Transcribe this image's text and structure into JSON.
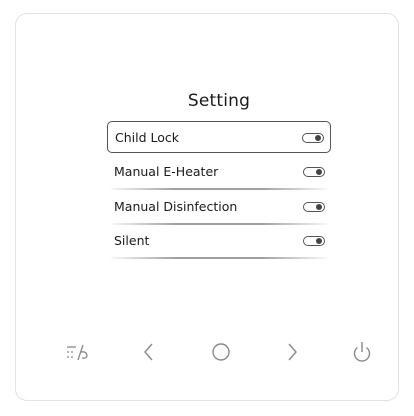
{
  "screen": {
    "title": "Setting",
    "items": [
      {
        "label": "Child Lock",
        "toggle": "off",
        "selected": true
      },
      {
        "label": "Manual E-Heater",
        "toggle": "off",
        "selected": false
      },
      {
        "label": "Manual Disinfection",
        "toggle": "off",
        "selected": false
      },
      {
        "label": "Silent",
        "toggle": "off",
        "selected": false
      }
    ]
  },
  "buttons": {
    "mode_icon": "mode-icon",
    "left_icon": "chevron-left-icon",
    "ok_icon": "circle-icon",
    "right_icon": "chevron-right-icon",
    "power_icon": "power-icon"
  },
  "colors": {
    "panel_border": "#e3e3e3",
    "icon_stroke": "#888888",
    "text": "#1a1a1a"
  }
}
